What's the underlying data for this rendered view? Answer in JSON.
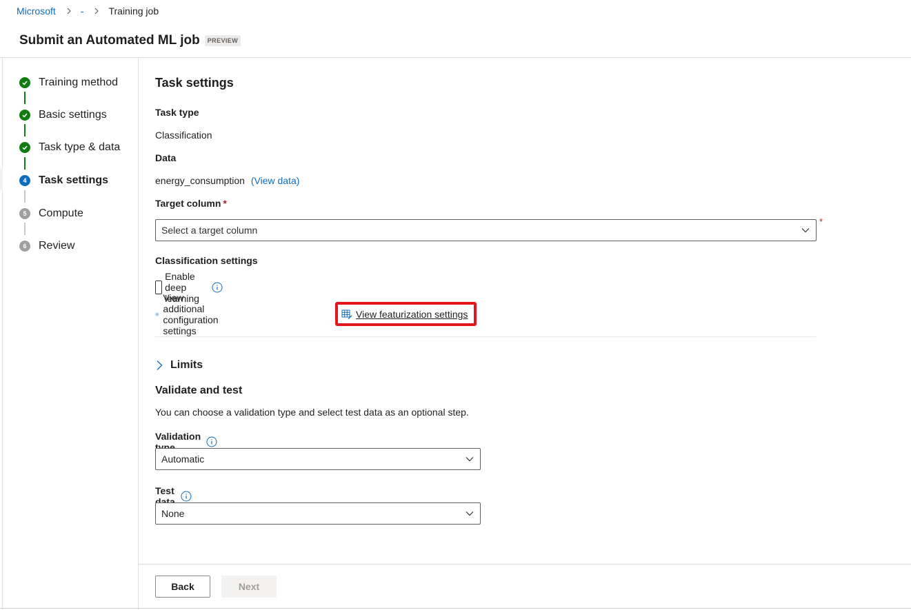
{
  "breadcrumb": {
    "items": [
      "Microsoft",
      "-",
      "Training job"
    ]
  },
  "header": {
    "title": "Submit an Automated ML job",
    "badge": "PREVIEW"
  },
  "steps": [
    {
      "label": "Training method",
      "status": "done",
      "number": "1"
    },
    {
      "label": "Basic settings",
      "status": "done",
      "number": "2"
    },
    {
      "label": "Task type & data",
      "status": "done",
      "number": "3"
    },
    {
      "label": "Task settings",
      "status": "current",
      "number": "4"
    },
    {
      "label": "Compute",
      "status": "pending",
      "number": "5"
    },
    {
      "label": "Review",
      "status": "pending",
      "number": "6"
    }
  ],
  "main": {
    "section_title": "Task settings",
    "task_type_label": "Task type",
    "task_type_value": "Classification",
    "data_label": "Data",
    "data_value": "energy_consumption",
    "view_data_link": "(View data)",
    "target_column_label": "Target column",
    "required_marker": "*",
    "target_column_placeholder": "Select a target column",
    "classification_settings_label": "Classification settings",
    "enable_deep_learning_label": "Enable deep learning",
    "enable_deep_learning_checked": false,
    "additional_config_label": "View additional configuration settings",
    "featurization_label": "View featurization settings",
    "limits_label": "Limits",
    "validate_title": "Validate and test",
    "validate_desc": "You can choose a validation type and select test data as an optional step.",
    "validation_type_label": "Validation type",
    "validation_type_value": "Automatic",
    "test_data_label": "Test data",
    "test_data_value": "None"
  },
  "footer": {
    "back_label": "Back",
    "next_label": "Next"
  },
  "colors": {
    "accent": "#0f6cbd",
    "success": "#107c10",
    "required": "#a4262c",
    "highlight": "#e3161c"
  }
}
